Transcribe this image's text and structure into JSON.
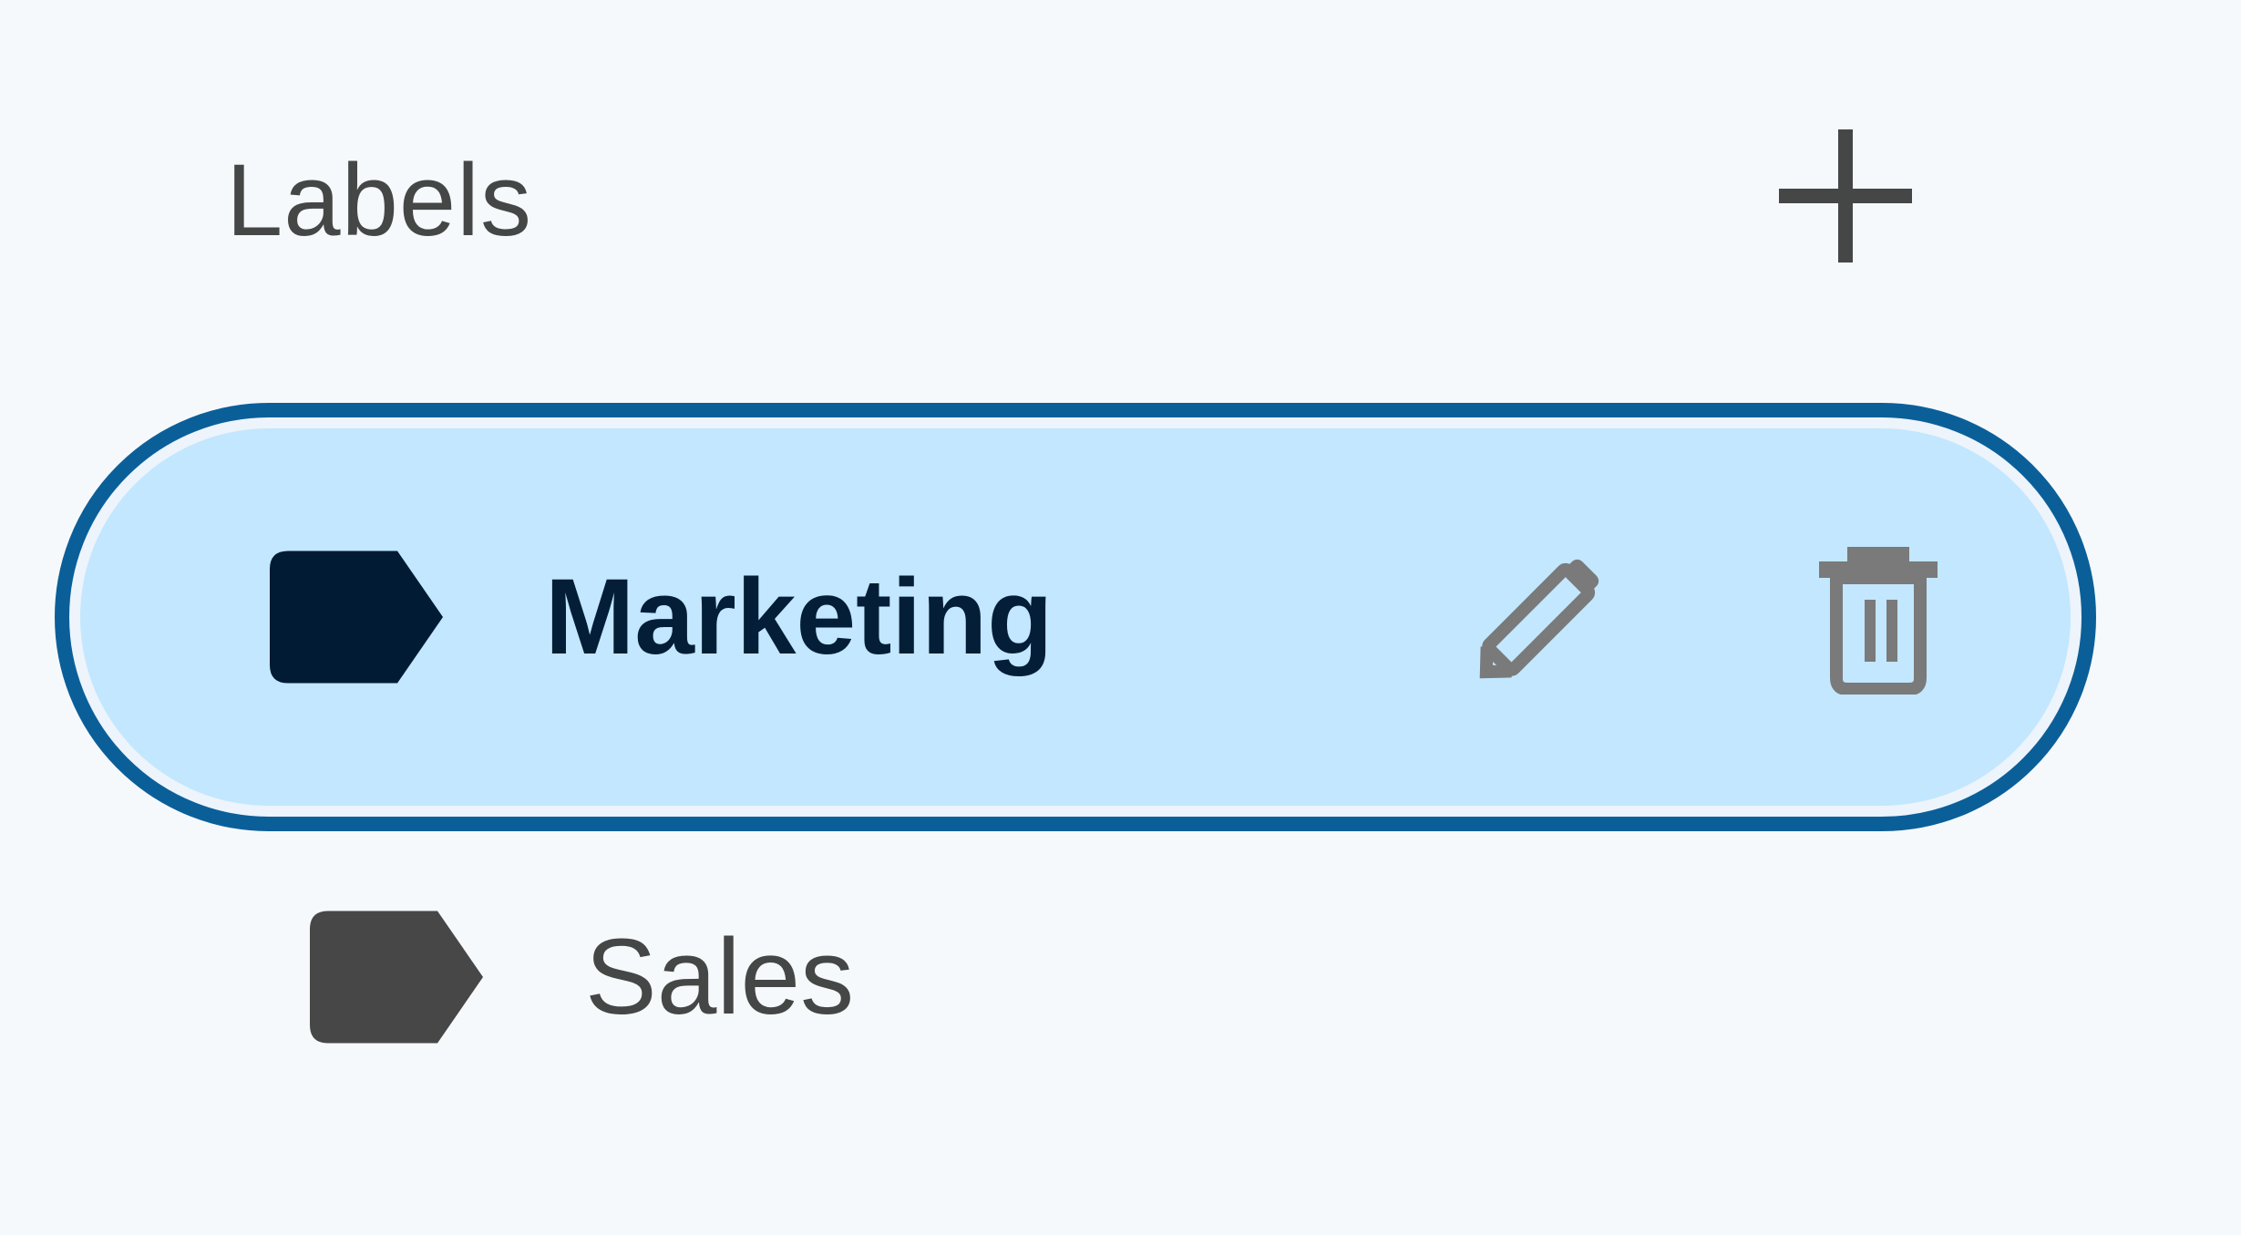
{
  "labels_panel": {
    "title": "Labels",
    "add_icon": "plus-icon",
    "items": [
      {
        "label": "Marketing",
        "state": "selected",
        "label_icon": "label-tag-icon",
        "label_icon_color": "#001b33",
        "edit_icon": "pencil-icon",
        "delete_icon": "trash-icon"
      },
      {
        "label": "Sales",
        "state": "default",
        "label_icon": "label-tag-icon",
        "label_icon_color": "#474747"
      }
    ],
    "colors": {
      "background": "#f6f9fc",
      "selected_background": "#c2e7ff",
      "selected_outline": "#0b5f99",
      "text_primary": "#444746",
      "text_selected": "#041e37",
      "icon_muted": "#7a7a7a"
    }
  }
}
